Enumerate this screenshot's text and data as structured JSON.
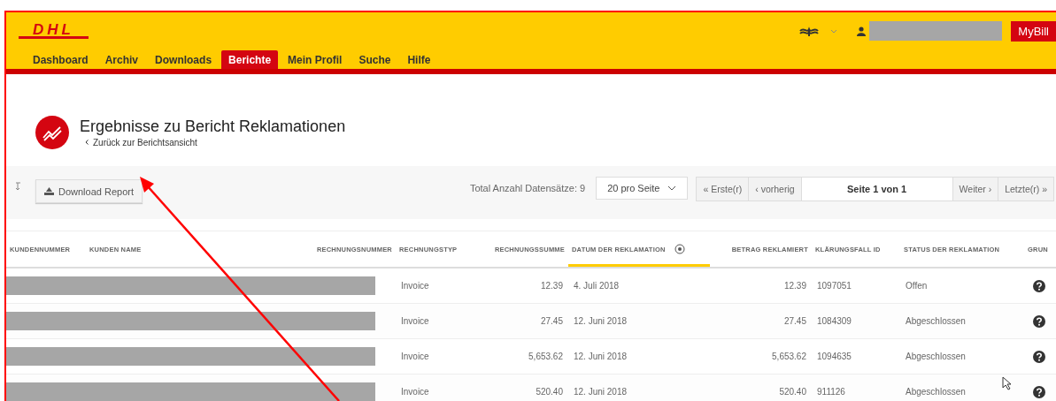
{
  "header": {
    "logo": "DHL",
    "button": "MyBill"
  },
  "nav": [
    {
      "label": "Dashboard",
      "selected": false
    },
    {
      "label": "Archiv",
      "selected": false
    },
    {
      "label": "Downloads",
      "selected": false
    },
    {
      "label": "Berichte",
      "selected": true
    },
    {
      "label": "Mein Profil",
      "selected": false
    },
    {
      "label": "Suche",
      "selected": false
    },
    {
      "label": "Hilfe",
      "selected": false
    }
  ],
  "page": {
    "title": "Ergebnisse zu Bericht Reklamationen",
    "back_link": "Zurück zur Berichtsansicht"
  },
  "toolbar": {
    "download_button": "Download Report",
    "total": "Total Anzahl Datensätze: 9",
    "per_page": "20 pro Seite",
    "pagination": [
      {
        "label": "« Erste(r)",
        "kind": "button"
      },
      {
        "label": "‹ vorherig",
        "kind": "button"
      },
      {
        "label": "Seite 1 von 1",
        "kind": "info"
      },
      {
        "label": "Weiter ›",
        "kind": "button"
      },
      {
        "label": "Letzte(r) »",
        "kind": "button"
      }
    ]
  },
  "table": {
    "columns": [
      {
        "label": "KUNDENNUMMER",
        "sorted": false
      },
      {
        "label": "KUNDEN NAME",
        "sorted": false
      },
      {
        "label": "RECHNUNGSNUMMER",
        "sorted": false
      },
      {
        "label": "RECHNUNGSTYP",
        "sorted": false
      },
      {
        "label": "RECHNUNGSSUMME",
        "sorted": false
      },
      {
        "label": "DATUM DER REKLAMATION",
        "sorted": true
      },
      {
        "label": "BETRAG REKLAMIERT",
        "sorted": false
      },
      {
        "label": "KLÄRUNGSFALL ID",
        "sorted": false
      },
      {
        "label": "STATUS DER REKLAMATION",
        "sorted": false
      },
      {
        "label": "GRUN",
        "sorted": false
      }
    ],
    "rows": [
      {
        "type": "Invoice",
        "sum": "12.39",
        "date": "4. Juli 2018",
        "claimed": "12.39",
        "case_id": "1097051",
        "status": "Offen"
      },
      {
        "type": "Invoice",
        "sum": "27.45",
        "date": "12. Juni 2018",
        "claimed": "27.45",
        "case_id": "1084309",
        "status": "Abgeschlossen"
      },
      {
        "type": "Invoice",
        "sum": "5,653.62",
        "date": "12. Juni 2018",
        "claimed": "5,653.62",
        "case_id": "1094635",
        "status": "Abgeschlossen"
      },
      {
        "type": "Invoice",
        "sum": "520.40",
        "date": "12. Juni 2018",
        "claimed": "520.40",
        "case_id": "911126",
        "status": "Abgeschlossen"
      }
    ]
  }
}
